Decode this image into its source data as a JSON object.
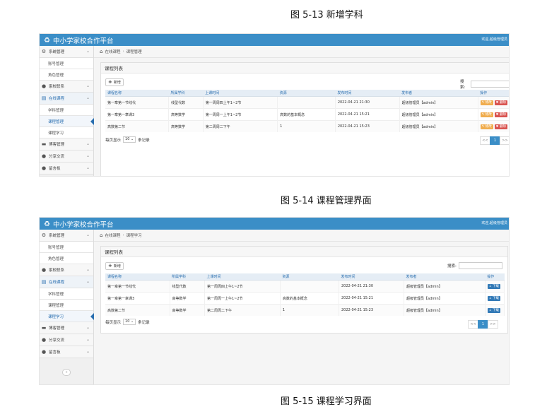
{
  "captions": {
    "top": "图 5-13 新增学科",
    "middle": "图 5-14 课程管理界面",
    "bottom": "图 5-15 课程学习界面"
  },
  "app": {
    "title": "中小学家校合作平台",
    "welcome": "欢迎,超级管理员"
  },
  "sidebar": {
    "groups": [
      {
        "label": "系统管理",
        "icon": "gear-icon"
      },
      {
        "label": "家校联系",
        "icon": "tag-icon"
      },
      {
        "label": "在线课程",
        "icon": "book-icon"
      },
      {
        "label": "博客管理",
        "icon": "blog-icon"
      },
      {
        "label": "分享交流",
        "icon": "chat-icon"
      },
      {
        "label": "留言板",
        "icon": "comment-icon"
      }
    ],
    "sub_system": [
      "账号管理",
      "角色管理"
    ],
    "sub_course": [
      "学科管理",
      "课程管理",
      "课程学习"
    ]
  },
  "screen1": {
    "breadcrumb": [
      "在线课程",
      "课程管理"
    ],
    "panel_title": "课程列表",
    "add_label": "新增",
    "search_label": "搜索:",
    "columns": [
      "课程名称",
      "所属学科",
      "上课时间",
      "资源",
      "发布时间",
      "发布者",
      "操作"
    ],
    "rows": [
      [
        "第一章第一节线代",
        "线型代数",
        "第一周周四上午1~2节",
        "",
        "2022-04-21 21:30",
        "超级管理员【admin】"
      ],
      [
        "第一章第一章课3",
        "高等数学",
        "第一周周一上午1~2节",
        "高数的基本概念",
        "2022-04-21 15:21",
        "超级管理员【admin】"
      ],
      [
        "高数第二节",
        "高等数学",
        "第二周周二下午",
        "1",
        "2022-04-21 15:23",
        "超级管理员【admin】"
      ]
    ],
    "edit_label": "修改",
    "delete_label": "删除",
    "per_page_prefix": "每页显示",
    "per_page_value": "10",
    "per_page_suffix": "条记录",
    "pager": [
      "<<",
      "1",
      ">>"
    ]
  },
  "screen2": {
    "breadcrumb": [
      "在线课程",
      "课程学习"
    ],
    "panel_title": "课程列表",
    "add_label": "新增",
    "search_label": "搜索:",
    "columns": [
      "课程名称",
      "所属学科",
      "上课时间",
      "资源",
      "发布时间",
      "发布者",
      "操作"
    ],
    "rows": [
      [
        "第一章第一节线代",
        "线型代数",
        "第一周周四上午1~2节",
        "",
        "2022-04-21 21:30",
        "超级管理员【admin】"
      ],
      [
        "第一章第一章课3",
        "高等数学",
        "第一周周一上午1~2节",
        "高数的基本概念",
        "2022-04-21 15:21",
        "超级管理员【admin】"
      ],
      [
        "高数第二节",
        "高等数学",
        "第二周周二下午",
        "1",
        "2022-04-21 15:23",
        "超级管理员【admin】"
      ]
    ],
    "download_label": "下载",
    "per_page_prefix": "每页显示",
    "per_page_value": "10",
    "per_page_suffix": "条记录",
    "pager": [
      "<<",
      "1",
      ">>"
    ]
  }
}
